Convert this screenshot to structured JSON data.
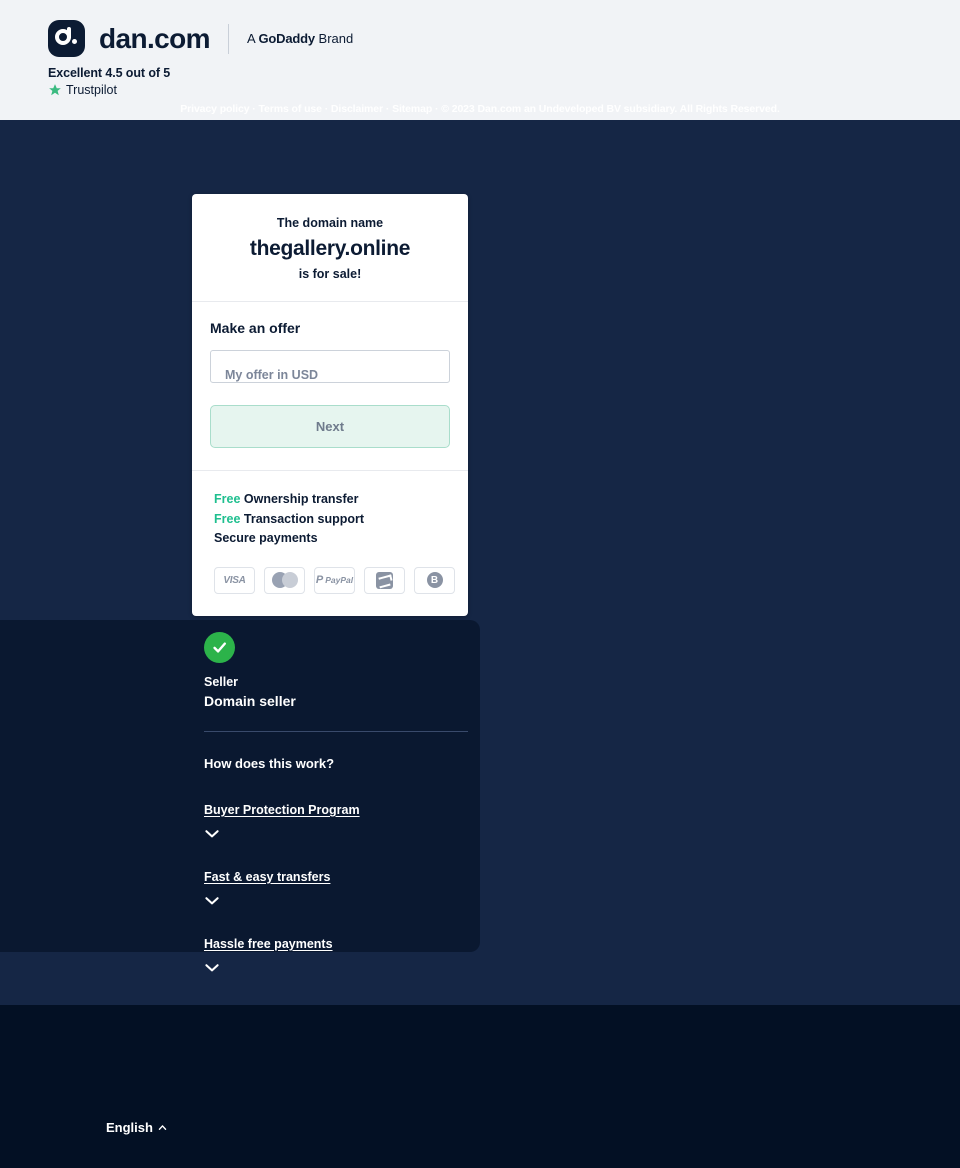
{
  "header": {
    "logo_word": "dan.com",
    "logo_icon": "dan-logo-icon",
    "godaddy_prefix": "A ",
    "godaddy_name": "GoDaddy",
    "godaddy_suffix": " Brand",
    "trustpilot": {
      "score_text": "Excellent 4.5 out of 5",
      "name": "Trustpilot",
      "star_color": "#3aba80"
    }
  },
  "card": {
    "line1": "The domain name",
    "domain": "thegallery.online",
    "line3": "is for sale!",
    "make_offer_title": "Make an offer",
    "offer_placeholder": "My offer in USD",
    "offer_value": "",
    "next_label": "Next",
    "perks": [
      {
        "free": "Free",
        "text": " Ownership transfer"
      },
      {
        "free": "Free",
        "text": " Transaction support"
      },
      {
        "free": "",
        "text": "Secure payments"
      }
    ],
    "payments": [
      {
        "name": "visa",
        "label": "VISA"
      },
      {
        "name": "mastercard",
        "label": ""
      },
      {
        "name": "paypal",
        "label": "PayPal"
      },
      {
        "name": "alipay",
        "label": ""
      },
      {
        "name": "bitcoin",
        "label": "B"
      }
    ]
  },
  "seller": {
    "verified_icon": "verified-check-icon",
    "label": "Seller",
    "name": "Domain seller"
  },
  "faq": {
    "title": "How does this work?",
    "items": [
      {
        "question": "Buyer Protection Program"
      },
      {
        "question": "Fast & easy transfers"
      },
      {
        "question": "Hassle free payments"
      }
    ]
  },
  "footer": {
    "links": [
      "Privacy policy",
      "Terms of use",
      "Disclaimer",
      "Sitemap"
    ],
    "separator": " · ",
    "copyright": "© 2023 Dan.com an Undeveloped BV subsidiary. All Rights Reserved.",
    "language": "English"
  },
  "colors": {
    "header_bg": "#f1f3f6",
    "stage_bg": "#152645",
    "panel_bg": "#0a1830",
    "footer_bg": "#031024",
    "accent_green": "#1fbf8f",
    "check_green": "#2cb34a",
    "next_bg": "#e6f5ef",
    "next_border": "#a9ddcb"
  }
}
